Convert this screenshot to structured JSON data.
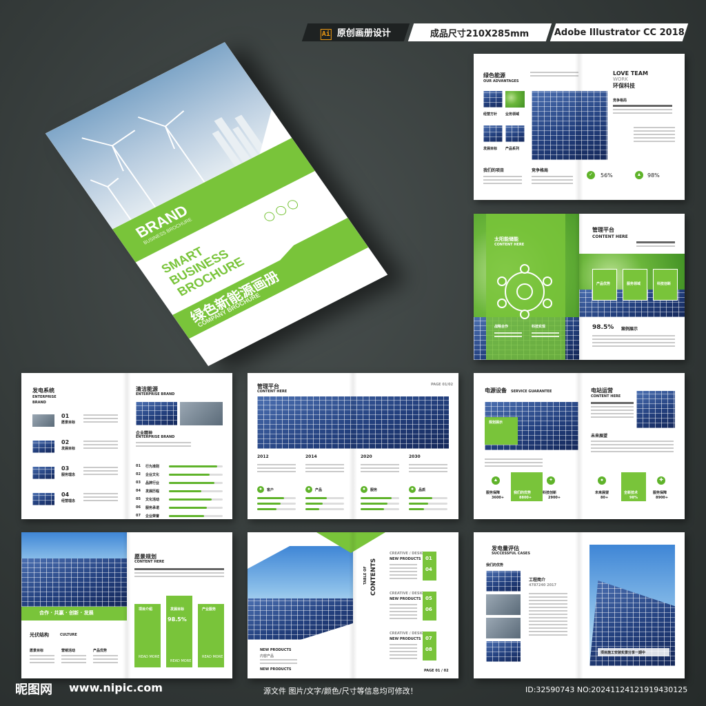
{
  "header": {
    "label1": "原创画册设计",
    "label2": "成品尺寸210X285mm",
    "label3": "Adobe Illustrator CC 2018",
    "ai_icon": "Ai"
  },
  "cover": {
    "brand": "BRAND",
    "brand_sub": "BUSINESS BROCHURE",
    "smart": "SMART BUSINESS BROCHURE",
    "cn_title": "绿色新能源画册",
    "cn_sub": "COMPANY BROCHURE"
  },
  "spread1": {
    "title": "绿色能源",
    "subtitle": "OUR ADVANTAGES",
    "right_title1": "LOVE TEAM",
    "right_title2": "WORK",
    "right_title3": "环保科技",
    "label_compete": "竞争格局",
    "label_projects": "我们的项目",
    "label_compete2": "竞争格局",
    "stat1": "56%",
    "stat2": "98%",
    "thumb_labels": [
      "经营方针",
      "业务领域",
      "发展目标",
      "产品系列"
    ]
  },
  "spread2": {
    "left_title": "太阳能储能",
    "left_sub": "CONTENT HERE",
    "right_title": "管理平台",
    "right_sub": "CONTENT HERE",
    "box_labels": [
      "产品优势",
      "服务领域",
      "科技创新"
    ],
    "node_labels": [
      "战略合作",
      "科技实现"
    ],
    "stat": "98.5%",
    "stat_label": "案例展示"
  },
  "spread3": {
    "title": "发电系统",
    "sub1": "ENTERPRISE",
    "sub2": "BRAND",
    "items": [
      {
        "num": "01",
        "label": "愿景目标"
      },
      {
        "num": "02",
        "label": "发展目标"
      },
      {
        "num": "03",
        "label": "服务理念"
      },
      {
        "num": "04",
        "label": "经营理念"
      }
    ],
    "right_title": "清洁能源",
    "right_sub": "ENTERPRISE BRAND",
    "spirit": "企业精神",
    "spirit_sub": "ENTERPRISE BRAND",
    "bars": [
      {
        "num": "01",
        "label": "行为准则",
        "value": 0.9
      },
      {
        "num": "02",
        "label": "企业文化",
        "value": 0.75
      },
      {
        "num": "03",
        "label": "品牌行业",
        "value": 0.85
      },
      {
        "num": "04",
        "label": "发展历程",
        "value": 0.6
      },
      {
        "num": "05",
        "label": "文化活动",
        "value": 0.8
      },
      {
        "num": "06",
        "label": "服务承诺",
        "value": 0.7
      },
      {
        "num": "07",
        "label": "企业荣誉",
        "value": 0.65
      },
      {
        "num": "08",
        "label": "销售业绩",
        "value": 0.55
      }
    ]
  },
  "spread4": {
    "title": "管理平台",
    "sub": "CONTENT HERE",
    "page": "PAGE 01/02",
    "years": [
      "2012",
      "2014",
      "2020",
      "2030"
    ],
    "tags": [
      "客户",
      "产品",
      "服务",
      "品质"
    ],
    "progress": [
      0.7,
      0.55,
      0.8,
      0.6
    ]
  },
  "spread5": {
    "title": "电源设备",
    "title_sub": "SERVICE GUARANTEE",
    "tag": "规划展示",
    "right_title": "电站运营",
    "right_sub": "CONTENT HERE",
    "future": "未来展望",
    "left_stats": [
      {
        "label": "服务保障",
        "value": "3600+"
      },
      {
        "label": "我们的优势",
        "value": "8800+"
      },
      {
        "label": "科技创新",
        "value": "2900+"
      }
    ],
    "right_stats": [
      {
        "label": "未来展望",
        "value": "80+"
      },
      {
        "label": "全新技术",
        "value": "98%"
      },
      {
        "label": "服务保障",
        "value": "8900+"
      }
    ]
  },
  "spread6": {
    "banner": "合作 · 共赢 · 创新 · 发展",
    "section": "光伏结构",
    "section_en": "CULTURE",
    "labels": [
      "愿景目标",
      "营销活动",
      "产品优势"
    ],
    "right_title": "愿景规划",
    "right_sub": "CONTENT HERE",
    "cards": [
      "项目介绍",
      "发展目标",
      "产业服务"
    ],
    "card_stat": "98.5%",
    "read_more": "READ MORE"
  },
  "spread7": {
    "toc_title": "CONTENTS",
    "toc_vertical": "TABLE OF",
    "sections": [
      {
        "head": "CREATIVE / DESIGN",
        "title": "NEW PRODUCTS",
        "a": "01",
        "b": "04"
      },
      {
        "head": "CREATIVE / DESIGN",
        "title": "NEW PRODUCTS",
        "a": "05",
        "b": "06"
      },
      {
        "head": "CREATIVE / DESIGN",
        "title": "NEW PRODUCTS",
        "a": "07",
        "b": "08"
      }
    ],
    "bottom_left": "NEW PRODUCTS",
    "bottom_left_cn": "内容产品",
    "bottom_left2": "NEW PRODUCTS",
    "page": "PAGE 01 / 02"
  },
  "spread8": {
    "title": "发电量评估",
    "sub": "SUCCESSFUL CASES",
    "advantages": "我们的优势",
    "profile": "工程简介",
    "phone": "4787240 2017",
    "bottom_bar": "项目施工安装实景分享一期中"
  },
  "footer": {
    "logo": "昵图网",
    "url": "www.nipic.com",
    "notice": "源文件 图片/文字/颜色/尺寸等信息均可修改！",
    "id": "ID:32590743 NO:20241124121919430125"
  },
  "colors": {
    "accent": "#79c43a",
    "background": "#343a39"
  }
}
